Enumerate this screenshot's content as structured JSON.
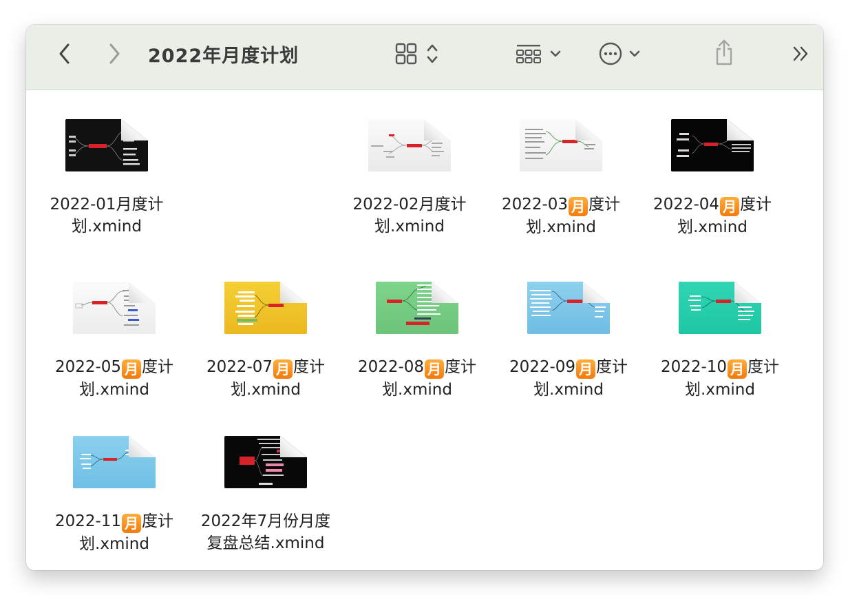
{
  "toolbar": {
    "title": "2022年月度计划",
    "icons": {
      "back": "chevron-left-icon",
      "forward": "chevron-right-icon",
      "view": "grid-view-icon",
      "group": "group-by-icon",
      "more": "more-ellipsis-icon",
      "share": "share-icon",
      "overflow": "double-chevron-right-icon"
    }
  },
  "files": [
    {
      "line1": "2022-01月度计",
      "line2": "划.xmind",
      "badge": false,
      "bg": "#111111"
    },
    {
      "line1": "2022-02月度计",
      "line2": "划.xmind",
      "badge": false,
      "bg": "#f3f3f3"
    },
    {
      "line1a": "2022-03",
      "badge_text": "月",
      "line1b": "度计",
      "line2": "划.xmind",
      "badge": true,
      "bg": "#f3f3f3"
    },
    {
      "line1a": "2022-04",
      "badge_text": "月",
      "line1b": "度计",
      "line2": "划.xmind",
      "badge": true,
      "bg": "#050505"
    },
    {
      "line1a": "2022-05",
      "badge_text": "月",
      "line1b": "度计",
      "line2": "划.xmind",
      "badge": true,
      "bg": "#f4f4f4"
    },
    {
      "line1a": "2022-07",
      "badge_text": "月",
      "line1b": "度计",
      "line2": "划.xmind",
      "badge": true,
      "bg": "#f0c530"
    },
    {
      "line1a": "2022-08",
      "badge_text": "月",
      "line1b": "度计",
      "line2": "划.xmind",
      "badge": true,
      "bg": "#77cf83"
    },
    {
      "line1a": "2022-09",
      "badge_text": "月",
      "line1b": "度计",
      "line2": "划.xmind",
      "badge": true,
      "bg": "#82c9ea"
    },
    {
      "line1a": "2022-10",
      "badge_text": "月",
      "line1b": "度计",
      "line2": "划.xmind",
      "badge": true,
      "bg": "#2ad1b0"
    },
    {
      "line1a": "2022-11",
      "badge_text": "月",
      "line1b": "度计",
      "line2": "划.xmind",
      "badge": true,
      "bg": "#7fc8ea"
    },
    {
      "line1": "2022年7月份月度",
      "line2": "复盘总结.xmind",
      "badge": false,
      "bg": "#080808"
    }
  ]
}
